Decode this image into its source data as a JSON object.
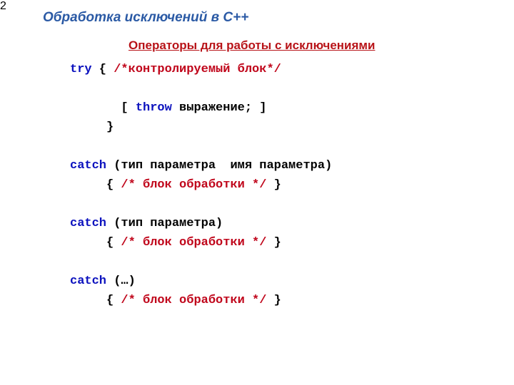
{
  "title": "Обработка исключений в C++",
  "subtitle": " Операторы для работы с исключениями",
  "code": {
    "l1_try": "try",
    "l1_rest": " { ",
    "l1_comment": "/*контролируемый блок*/",
    "l3_pre": "       [ ",
    "l3_throw": "throw",
    "l3_rest": " выражение; ]",
    "l4": "     }",
    "l5_catch": "catch",
    "l5_rest": " (тип параметра  имя параметра)",
    "l6_pre": "     { ",
    "l6_comment": "/* блок обработки */",
    "l6_post": " }",
    "l7_catch": "catch",
    "l7_rest": " (тип параметра)",
    "l8_pre": "     { ",
    "l8_comment": "/* блок обработки */",
    "l8_post": " }",
    "l9_catch": "catch",
    "l9_rest": " (…)",
    "l10_pre": "     { ",
    "l10_comment": "/* блок обработки */",
    "l10_post": " }"
  },
  "page": "2"
}
